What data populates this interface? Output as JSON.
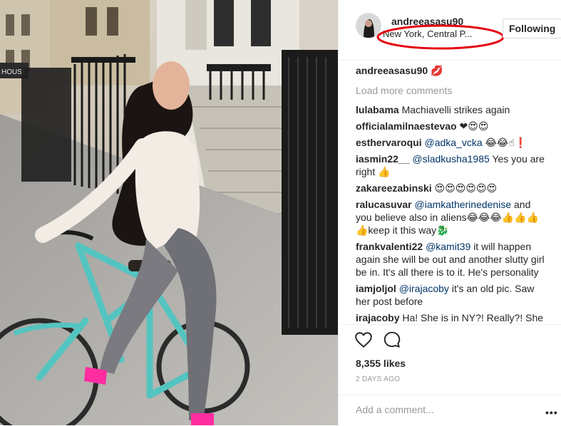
{
  "post": {
    "username": "andreeasasu90",
    "location": "New York, Central P...",
    "follow_label": "Following",
    "caption_user": "andreeasasu90",
    "caption_text": "💋",
    "load_more": "Load more comments",
    "comments": [
      {
        "user": "lulabama",
        "text": "Machiavelli strikes again"
      },
      {
        "user": "officialamilnaestevao",
        "text": "❤😍😍"
      },
      {
        "user": "esthervaroqui",
        "mention": "@adka_vcka",
        "text": "😂😂☝❗"
      },
      {
        "user": "iasmin22__",
        "mention": "@sladkusha1985",
        "text": "Yes you are right 👍"
      },
      {
        "user": "zakareezabinski",
        "text": "😍😍😍😍😍😍"
      },
      {
        "user": "ralucasuvar",
        "mention": "@iamkatherinedenise",
        "text": "and you believe also in aliens😂😂😂👍👍👍👍keep it this way🐉"
      },
      {
        "user": "frankvalenti22",
        "mention": "@kamit39",
        "text": "it will happen again she will be out and another slutty girl be in. It's all there is to it. He's personality"
      },
      {
        "user": "iamjoljol",
        "mention": "@irajacoby",
        "text": "it's an old pic. Saw her post before"
      },
      {
        "user": "irajacoby",
        "text": "Ha! She is in NY?! Really?! She is a"
      }
    ],
    "likes": "8,355 likes",
    "time_ago": "2 DAYS AGO",
    "add_comment_placeholder": "Add a comment...",
    "more_label": "•••"
  },
  "annotation": {
    "color": "#e5000f"
  },
  "photo": {
    "building_sign": "HOUSE"
  },
  "icons": {
    "like": "heart-icon",
    "comment": "comment-icon",
    "more": "more-options-icon"
  }
}
